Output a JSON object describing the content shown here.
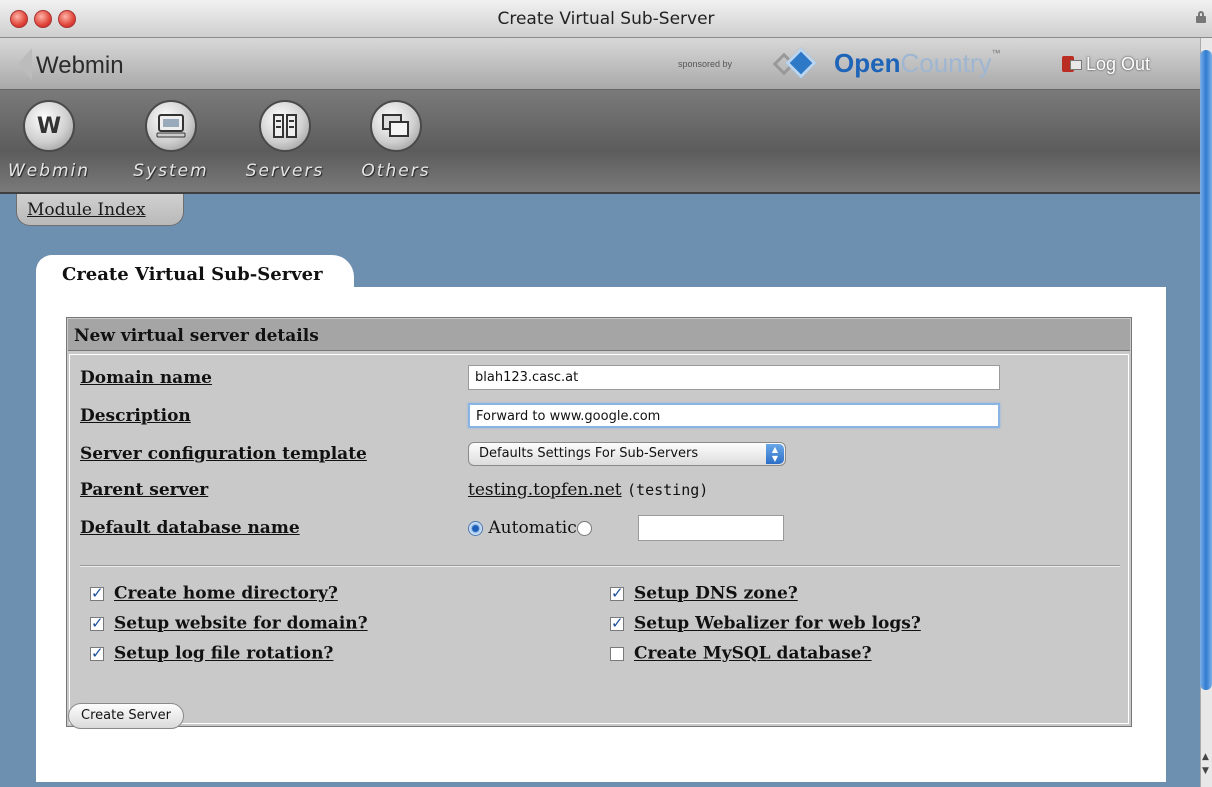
{
  "window": {
    "title": "Create Virtual Sub-Server"
  },
  "header": {
    "brand": "Webmin",
    "sponsored_text": "sponsored by",
    "sponsor_open": "Open",
    "sponsor_country": "Country",
    "sponsor_tm": "™",
    "logout_label": "Log Out"
  },
  "categories": [
    {
      "label": "Webmin",
      "icon": "webmin-icon"
    },
    {
      "label": "System",
      "icon": "computer-icon"
    },
    {
      "label": "Servers",
      "icon": "servers-icon"
    },
    {
      "label": "Others",
      "icon": "windows-icon"
    }
  ],
  "nav": {
    "module_index": "Module Index"
  },
  "page": {
    "tab_title": "Create Virtual Sub-Server"
  },
  "form": {
    "section_title": "New virtual server details",
    "domain_label": "Domain name",
    "domain_value": "blah123.casc.at",
    "description_label": "Description",
    "description_value": "Forward to www.google.com",
    "template_label": "Server configuration template",
    "template_value": "Defaults Settings For Sub-Servers",
    "parent_label": "Parent server",
    "parent_link": "testing.topfen.net",
    "parent_user": "(testing)",
    "dbname_label": "Default database name",
    "dbname_auto": "Automatic",
    "dbname_value": ""
  },
  "options": [
    {
      "label": "Create home directory?",
      "checked": true
    },
    {
      "label": "Setup website for domain?",
      "checked": true
    },
    {
      "label": "Setup log file rotation?",
      "checked": true
    },
    {
      "label": "Setup DNS zone?",
      "checked": true
    },
    {
      "label": "Setup Webalizer for web logs?",
      "checked": true
    },
    {
      "label": "Create MySQL database?",
      "checked": false
    }
  ],
  "actions": {
    "create_label": "Create Server"
  },
  "colors": {
    "background": "#6d8fb0",
    "panel": "#ffffff",
    "form_box": "#c9c9c9",
    "accent": "#2f7bd0"
  }
}
